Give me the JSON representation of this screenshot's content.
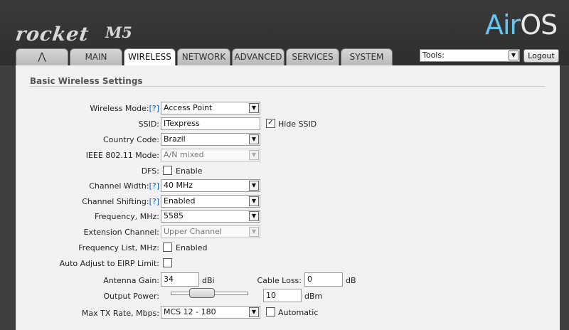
{
  "brand": {
    "name": "rocket",
    "model": "M5",
    "logo_prefix": "Air",
    "logo_suffix": "OS"
  },
  "tabs": {
    "logo": "⋀",
    "main": "MAIN",
    "wireless": "WIRELESS",
    "network": "NETWORK",
    "advanced": "ADVANCED",
    "services": "SERVICES",
    "system": "SYSTEM"
  },
  "tools": {
    "label": "Tools:",
    "arrow": "▼"
  },
  "logout": "Logout",
  "section": {
    "title": "Basic Wireless Settings"
  },
  "help": "[?]",
  "fields": {
    "wireless_mode": {
      "label": "Wireless Mode:",
      "value": "Access Point"
    },
    "ssid": {
      "label": "SSID:",
      "value": "ITexpress",
      "hide_label": "Hide SSID",
      "hide_checked": "✓"
    },
    "country_code": {
      "label": "Country Code:",
      "value": "Brazil"
    },
    "ieee_mode": {
      "label": "IEEE 802.11 Mode:",
      "value": "A/N mixed"
    },
    "dfs": {
      "label": "DFS:",
      "enable_label": "Enable"
    },
    "channel_width": {
      "label": "Channel Width:",
      "value": "40 MHz"
    },
    "channel_shifting": {
      "label": "Channel Shifting:",
      "value": "Enabled"
    },
    "frequency": {
      "label": "Frequency, MHz:",
      "value": "5585"
    },
    "extension_channel": {
      "label": "Extension Channel:",
      "value": "Upper Channel"
    },
    "frequency_list": {
      "label": "Frequency List, MHz:",
      "enabled_label": "Enabled"
    },
    "auto_adjust": {
      "label": "Auto Adjust to EIRP Limit:"
    },
    "antenna_gain": {
      "label": "Antenna Gain:",
      "value": "34",
      "unit": "dBi"
    },
    "cable_loss": {
      "label": "Cable Loss:",
      "value": "0",
      "unit": "dB"
    },
    "output_power": {
      "label": "Output Power:",
      "value": "10",
      "unit": "dBm",
      "slider_level": 0.35
    },
    "max_tx_rate": {
      "label": "Max TX Rate, Mbps:",
      "value": "MCS 12 - 180",
      "automatic_label": "Automatic"
    }
  },
  "colors": {
    "accent": "#0b5bb8",
    "logo_blue": "#66c4f0",
    "header_bg": "#3a3a3a"
  }
}
